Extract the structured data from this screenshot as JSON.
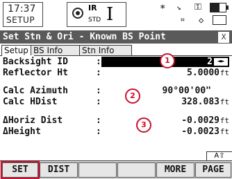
{
  "status": {
    "time": "17:37",
    "mode": "SETUP",
    "edm_mode": "IR",
    "edm_sub": "STD",
    "battery_level": 0.6,
    "icons": [
      "target-icon",
      "cursor-i-icon",
      "bluetooth-icon",
      "compensator-icon",
      "lock-icon",
      "battery-icon",
      "sd-card-icon",
      "drive-icon"
    ]
  },
  "title": {
    "text": "Set Stn & Ori - Known BS Point",
    "close": "X"
  },
  "tabs": [
    {
      "label": "Setup",
      "active": true
    },
    {
      "label": "BS Info",
      "active": false
    },
    {
      "label": "Stn Info",
      "active": false
    }
  ],
  "fields": {
    "backsight_id": {
      "label": "Backsight ID",
      "colon": ":",
      "value": "2",
      "arrows": "◄►"
    },
    "reflector_ht": {
      "label": "Reflector Ht",
      "colon": ":",
      "value": "5.0000",
      "unit": "ft"
    },
    "calc_azimuth": {
      "label": "Calc Azimuth",
      "colon": ":",
      "value": "90°00'00\"",
      "unit": ""
    },
    "calc_hdist": {
      "label": "Calc HDist",
      "colon": ":",
      "value": "328.083",
      "unit": "ft"
    },
    "dhoriz_dist": {
      "label": "ΔHoriz Dist",
      "colon": ":",
      "value": "-0.0029",
      "unit": "ft"
    },
    "dheight": {
      "label": "ΔHeight",
      "colon": ":",
      "value": "-0.0023",
      "unit": "ft"
    }
  },
  "callouts": [
    "1",
    "2",
    "3"
  ],
  "mode_indicator": "A⇧",
  "softkeys": [
    {
      "label": "SET",
      "highlighted": true
    },
    {
      "label": "DIST",
      "highlighted": false
    },
    {
      "label": "",
      "highlighted": false
    },
    {
      "label": "",
      "highlighted": false
    },
    {
      "label": "MORE",
      "highlighted": false
    },
    {
      "label": "PAGE",
      "highlighted": false
    }
  ],
  "colors": {
    "title_bar": "#5a5a5a",
    "callout": "#c8102e",
    "highlight": "#d01030"
  }
}
